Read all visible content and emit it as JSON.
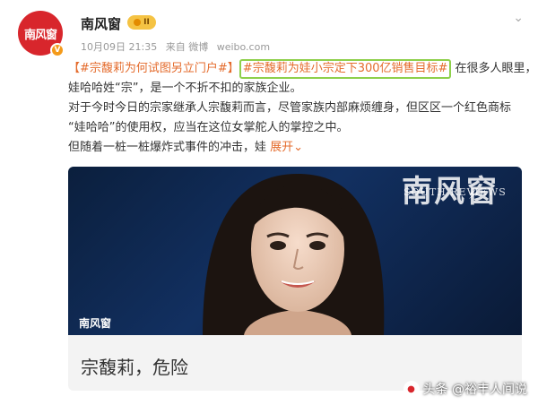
{
  "account": {
    "avatar_text": "南风窗",
    "verified_mark": "V",
    "name": "南风窗",
    "badge": "II",
    "date": "10月09日 21:35",
    "source": "来自 微博",
    "domain": "weibo.com"
  },
  "post": {
    "topic1": "【#宗馥莉为何试图另立门户#】",
    "topic2": "#宗馥莉为娃小宗定下300亿销售目标#",
    "line1_rest": " 在很多人眼里，",
    "line2": "娃哈哈姓“宗”，是一个不折不扣的家族企业。",
    "line3": "对于今时今日的宗家继承人宗馥莉而言，尽管家族内部麻烦缠身，但区区一个红色商标",
    "line4": "“娃哈哈”的使用权，应当在这位女掌舵人的掌控之中。",
    "line5": "但随着一桩一桩爆炸式事件的冲击，娃 ",
    "expand": "展开",
    "expand_icon": "chevron-down"
  },
  "card": {
    "watermark_big": "南风窗",
    "watermark_small": "SOUTH REVIEWS",
    "source_label": "南风窗",
    "title": "宗馥莉，危险"
  },
  "footer": {
    "watermark": "头条 @裕丰人间说"
  },
  "colors": {
    "topic": "#e46b2c",
    "highlight_box": "#8ed04b",
    "avatar_bg": "#d8262c",
    "card_bg": "#0f2750"
  }
}
